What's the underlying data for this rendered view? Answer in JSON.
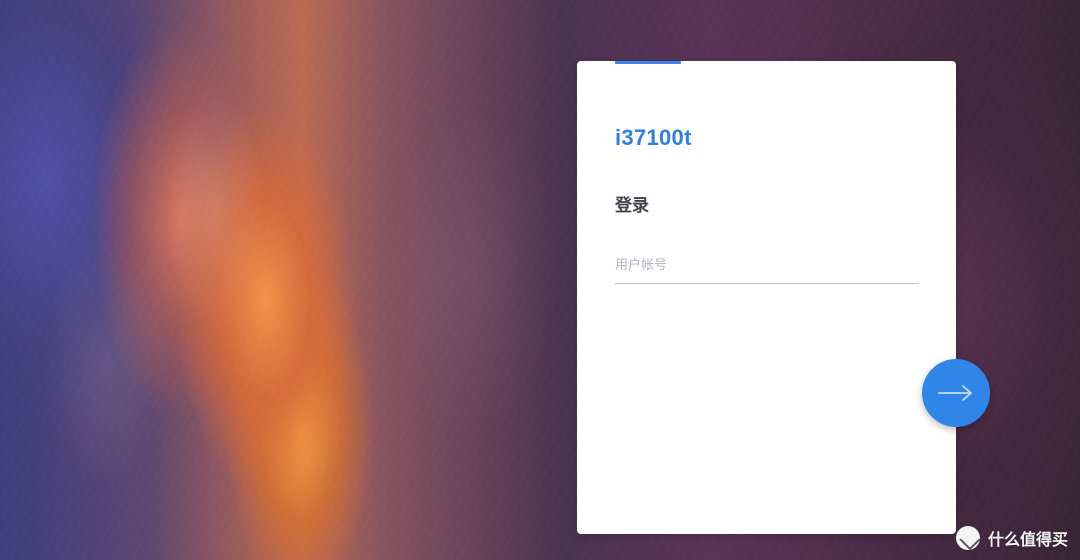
{
  "login": {
    "server_name": "i37100t",
    "title": "登录",
    "username_placeholder": "用户帐号",
    "username_value": ""
  },
  "actions": {
    "next_button_icon": "arrow-right-icon"
  },
  "watermark": {
    "text": "什么值得买",
    "logo_icon": "smzdm-logo-icon"
  },
  "colors": {
    "accent": "#2e7fe4",
    "button": "#2f86e8",
    "card_background": "#ffffff",
    "title_text": "#3f434a",
    "placeholder_text": "#b0b6be",
    "underline": "#bcc3cc"
  }
}
